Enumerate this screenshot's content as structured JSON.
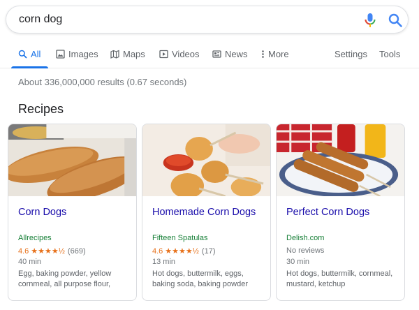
{
  "search": {
    "query": "corn dog"
  },
  "tabs": [
    {
      "label": "All",
      "icon": "search-icon",
      "active": true
    },
    {
      "label": "Images",
      "icon": "image-icon"
    },
    {
      "label": "Maps",
      "icon": "map-icon"
    },
    {
      "label": "Videos",
      "icon": "video-icon"
    },
    {
      "label": "News",
      "icon": "news-icon"
    },
    {
      "label": "More",
      "icon": "more-vert-icon"
    },
    {
      "label": "Settings"
    },
    {
      "label": "Tools"
    }
  ],
  "results": {
    "stats": "About 336,000,000 results (0.67 seconds)"
  },
  "recipes": {
    "heading": "Recipes",
    "cards": [
      {
        "title": "Corn Dogs",
        "source": "Allrecipes",
        "rating": "4.6",
        "stars": "★★★★½",
        "reviews": "(669)",
        "time": "40 min",
        "ingredients": "Egg, baking powder, yellow cornmeal, all purpose flour,"
      },
      {
        "title": "Homemade Corn Dogs",
        "source": "Fifteen Spatulas",
        "rating": "4.6",
        "stars": "★★★★½",
        "reviews": "(17)",
        "time": "13 min",
        "ingredients": "Hot dogs, buttermilk, eggs, baking soda, baking powder"
      },
      {
        "title": "Perfect Corn Dogs",
        "source": "Delish.com",
        "no_reviews": "No reviews",
        "time": "30 min",
        "ingredients": "Hot dogs, buttermilk, cornmeal, mustard, ketchup"
      }
    ]
  },
  "colors": {
    "link": "#1a0dab",
    "accent": "#1a73e8",
    "source": "#188038",
    "star": "#e7711b"
  }
}
